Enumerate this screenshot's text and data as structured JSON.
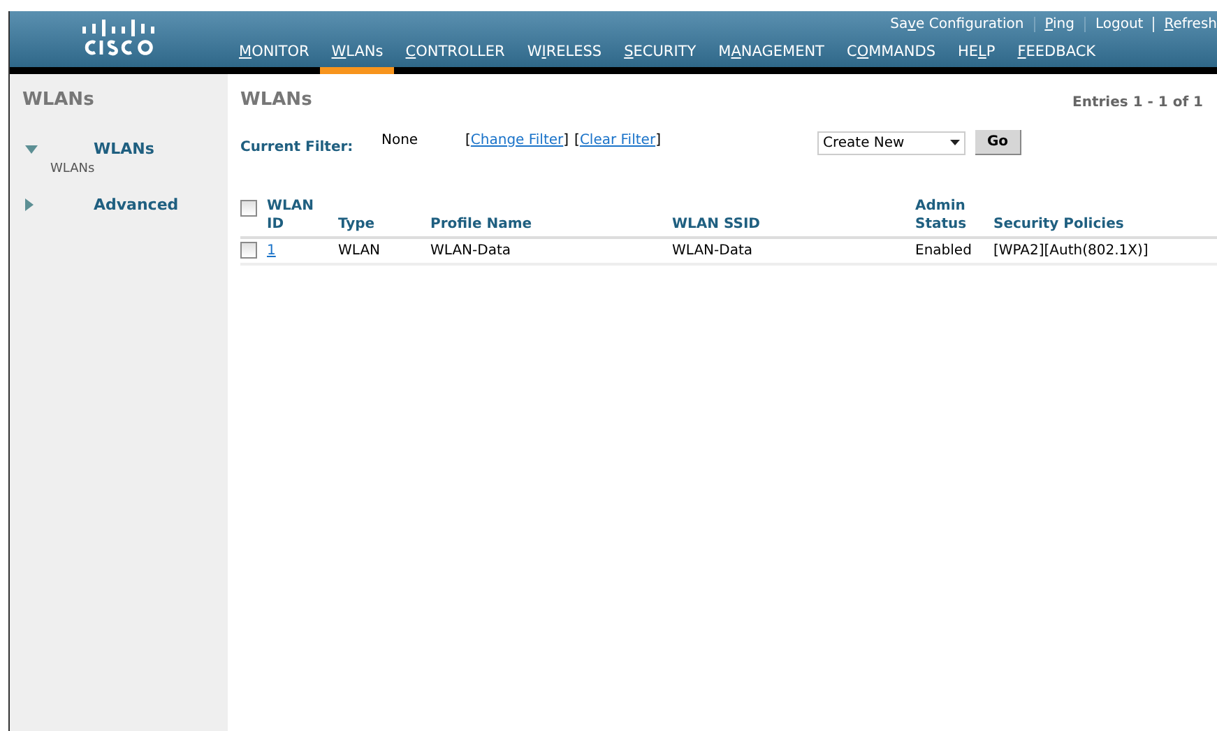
{
  "top_links": [
    {
      "pre": "Sa",
      "key": "v",
      "post": "e Configuration"
    },
    {
      "key": "P",
      "post": "ing"
    },
    {
      "pre": "Lo",
      "key": "g",
      "post": "out"
    },
    {
      "key": "R",
      "post": "efresh"
    }
  ],
  "menu": [
    {
      "key": "M",
      "post": "ONITOR",
      "selected": false
    },
    {
      "key": "W",
      "post": "LANs",
      "selected": true
    },
    {
      "key": "C",
      "post": "ONTROLLER",
      "selected": false
    },
    {
      "pre": "W",
      "key": "I",
      "post": "RELESS",
      "selected": false
    },
    {
      "key": "S",
      "post": "ECURITY",
      "selected": false
    },
    {
      "pre": "M",
      "key": "A",
      "post": "NAGEMENT",
      "selected": false
    },
    {
      "pre": "C",
      "key": "O",
      "post": "MMANDS",
      "selected": false
    },
    {
      "pre": "HE",
      "key": "L",
      "post": "P",
      "selected": false
    },
    {
      "key": "F",
      "post": "EEDBACK",
      "selected": false
    }
  ],
  "sidebar": {
    "title": "WLANs",
    "items": [
      {
        "label": "WLANs",
        "expanded": true,
        "children": [
          {
            "label": "WLANs"
          }
        ]
      },
      {
        "label": "Advanced",
        "expanded": false
      }
    ]
  },
  "main": {
    "title": "WLANs",
    "entries": "Entries 1 - 1 of 1",
    "filter_label": "Current Filter:",
    "filter_value": "None",
    "filter_links": [
      {
        "open": "[",
        "label": "Change Filter",
        "close": "]"
      },
      {
        "open": "[",
        "label": "Clear Filter",
        "close": "]"
      }
    ],
    "action_select": "Create New",
    "go": "Go"
  },
  "table": {
    "select_all_checked": false,
    "columns": [
      "WLAN ID",
      "Type",
      "Profile Name",
      "WLAN SSID",
      "Admin Status",
      "Security Policies"
    ],
    "rows": [
      {
        "checked": false,
        "cells": [
          "1",
          "WLAN",
          "WLAN-Data",
          "WLAN-Data",
          "Enabled",
          "[WPA2][Auth(802.1X)]"
        ]
      }
    ]
  }
}
